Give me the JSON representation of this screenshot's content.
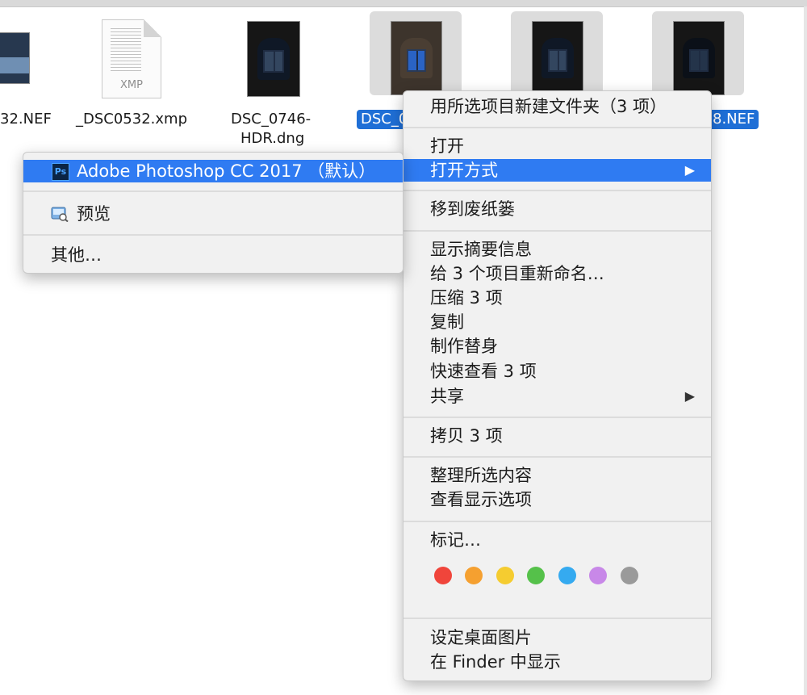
{
  "files": [
    {
      "name": "32.NEF"
    },
    {
      "name": "_DSC0532.xmp",
      "doc_badge": "XMP"
    },
    {
      "name_line1": "DSC_0746-",
      "name_line2": "HDR.dng"
    },
    {
      "name": "DSC_0"
    },
    {
      "name": "8.NEF"
    }
  ],
  "context_menu": {
    "new_folder": "用所选项目新建文件夹（3 项）",
    "open": "打开",
    "open_with": "打开方式",
    "move_to_trash": "移到废纸篓",
    "get_info": "显示摘要信息",
    "rename": "给 3 个项目重新命名…",
    "compress": "压缩 3 项",
    "duplicate": "复制",
    "make_alias": "制作替身",
    "quick_look": "快速查看 3 项",
    "share": "共享",
    "copy": "拷贝 3 项",
    "clean_up": "整理所选内容",
    "view_options": "查看显示选项",
    "tags": "标记…",
    "set_desktop": "设定桌面图片",
    "show_in_finder": "在 Finder 中显示",
    "submenu_arrow": "▶"
  },
  "tag_colors": [
    "#f0453b",
    "#f5a030",
    "#f5cc30",
    "#55c14a",
    "#35aaf0",
    "#c888e8",
    "#9a9a9a"
  ],
  "open_with_submenu": {
    "photoshop": "Adobe Photoshop CC 2017 （默认）",
    "ps_icon": "Ps",
    "preview": "预览",
    "other": "其他…"
  },
  "colors": {
    "highlight": "#2f7bf2",
    "selection_label": "#1f6fd6"
  }
}
